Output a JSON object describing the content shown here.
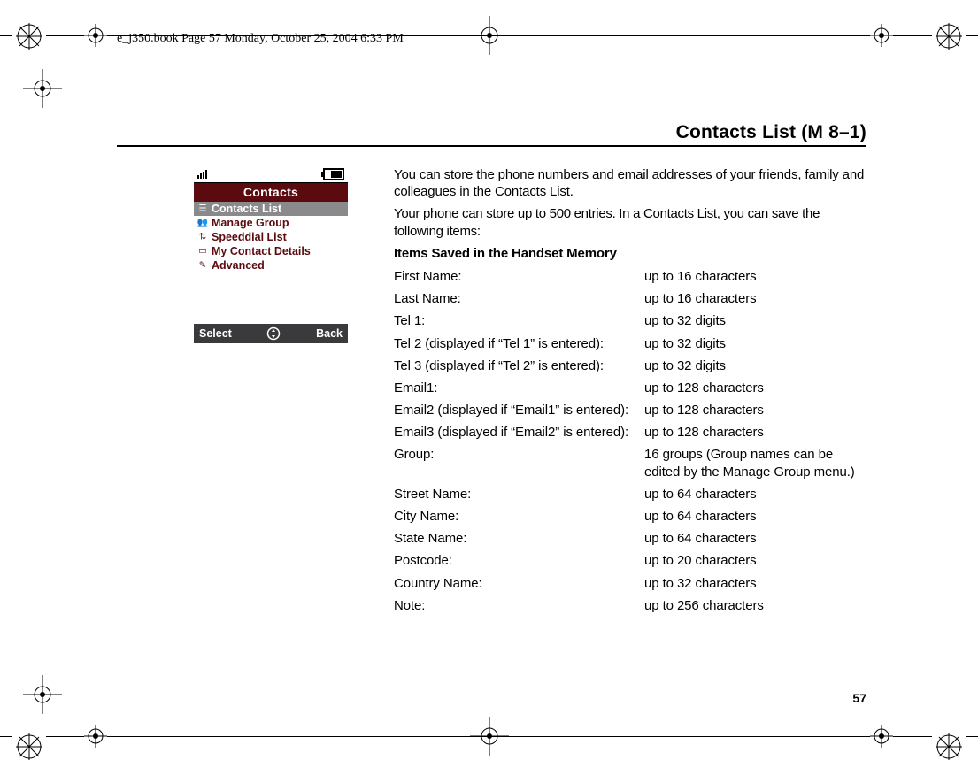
{
  "meta": {
    "header_note": "e_j350.book  Page 57  Monday, October 25, 2004  6:33 PM"
  },
  "page": {
    "title": "Contacts List (M 8–1)",
    "number": "57"
  },
  "phone": {
    "titlebar": "Contacts",
    "menu": [
      {
        "icon": "list-icon",
        "label": "Contacts List",
        "selected": true
      },
      {
        "icon": "group-icon",
        "label": "Manage Group",
        "selected": false
      },
      {
        "icon": "speeddial-icon",
        "label": "Speeddial List",
        "selected": false
      },
      {
        "icon": "card-icon",
        "label": "My Contact Details",
        "selected": false
      },
      {
        "icon": "advanced-icon",
        "label": "Advanced",
        "selected": false
      }
    ],
    "softkeys": {
      "left": "Select",
      "right": "Back"
    }
  },
  "intro": {
    "p1": "You can store the phone numbers and email addresses of your friends, family and colleagues in the Contacts List.",
    "p2": "Your phone can store up to 500 entries. In a Contacts List, you can save the following items:"
  },
  "items_heading": "Items Saved in the Handset Memory",
  "items": [
    {
      "label": "First Name:",
      "value": "up to 16 characters"
    },
    {
      "label": "Last Name:",
      "value": "up to 16 characters"
    },
    {
      "label": "Tel 1:",
      "value": "up to 32 digits"
    },
    {
      "label": "Tel 2 (displayed if “Tel 1” is entered):",
      "value": "up to 32 digits"
    },
    {
      "label": "Tel 3 (displayed if “Tel 2” is entered):",
      "value": "up to 32 digits"
    },
    {
      "label": "Email1:",
      "value": "up to 128 characters"
    },
    {
      "label": "Email2 (displayed if “Email1” is entered):",
      "value": "up to 128 characters"
    },
    {
      "label": "Email3 (displayed if “Email2” is entered):",
      "value": "up to 128 characters"
    },
    {
      "label": "Group:",
      "value": "16 groups (Group names can be edited by the Manage Group menu.)"
    },
    {
      "label": "Street Name:",
      "value": "up to 64 characters"
    },
    {
      "label": "City Name:",
      "value": "up to 64 characters"
    },
    {
      "label": "State Name:",
      "value": "up to 64 characters"
    },
    {
      "label": "Postcode:",
      "value": "up to 20 characters"
    },
    {
      "label": "Country Name:",
      "value": "up to 32 characters"
    },
    {
      "label": "Note:",
      "value": "up to 256 characters"
    }
  ]
}
